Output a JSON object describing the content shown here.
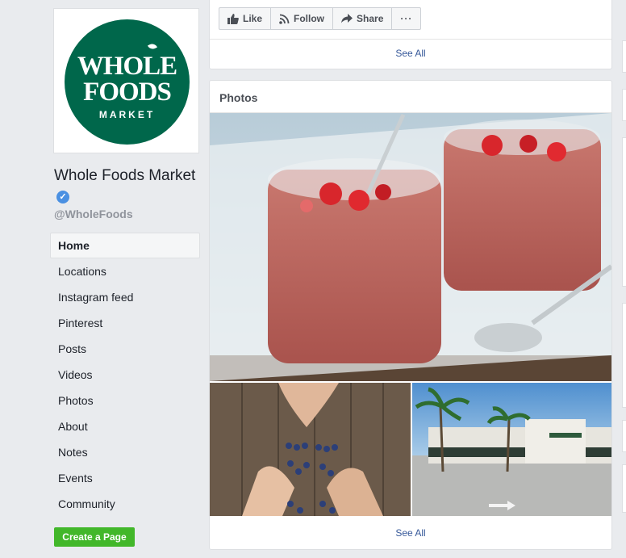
{
  "page": {
    "name": "Whole Foods Market",
    "handle": "@WholeFoods"
  },
  "logo": {
    "line1": "WHOLE",
    "line2": "FOODS",
    "line3": "MARKET",
    "color": "#00674b"
  },
  "verified_glyph": "✓",
  "nav": {
    "items": [
      {
        "label": "Home",
        "active": true
      },
      {
        "label": "Locations"
      },
      {
        "label": "Instagram feed"
      },
      {
        "label": "Pinterest"
      },
      {
        "label": "Posts"
      },
      {
        "label": "Videos"
      },
      {
        "label": "Photos"
      },
      {
        "label": "About"
      },
      {
        "label": "Notes"
      },
      {
        "label": "Events"
      },
      {
        "label": "Community"
      }
    ]
  },
  "create_page_label": "Create a Page",
  "actions": {
    "like": "Like",
    "follow": "Follow",
    "share": "Share",
    "more": "···"
  },
  "top_card": {
    "see_all": "See All"
  },
  "photos": {
    "title": "Photos",
    "see_all": "See All",
    "items": [
      {
        "subject": "strawberry smoothie glasses"
      },
      {
        "subject": "hands making hearts with blueberries"
      },
      {
        "subject": "Whole Foods store exterior with palm trees"
      }
    ]
  },
  "icons": [
    "like-icon",
    "follow-icon",
    "share-icon",
    "more-icon",
    "verified-badge-icon"
  ],
  "colors": {
    "background": "#e9ebee",
    "link": "#365899",
    "create_button": "#42b72a",
    "verified": "#4a90e2"
  }
}
